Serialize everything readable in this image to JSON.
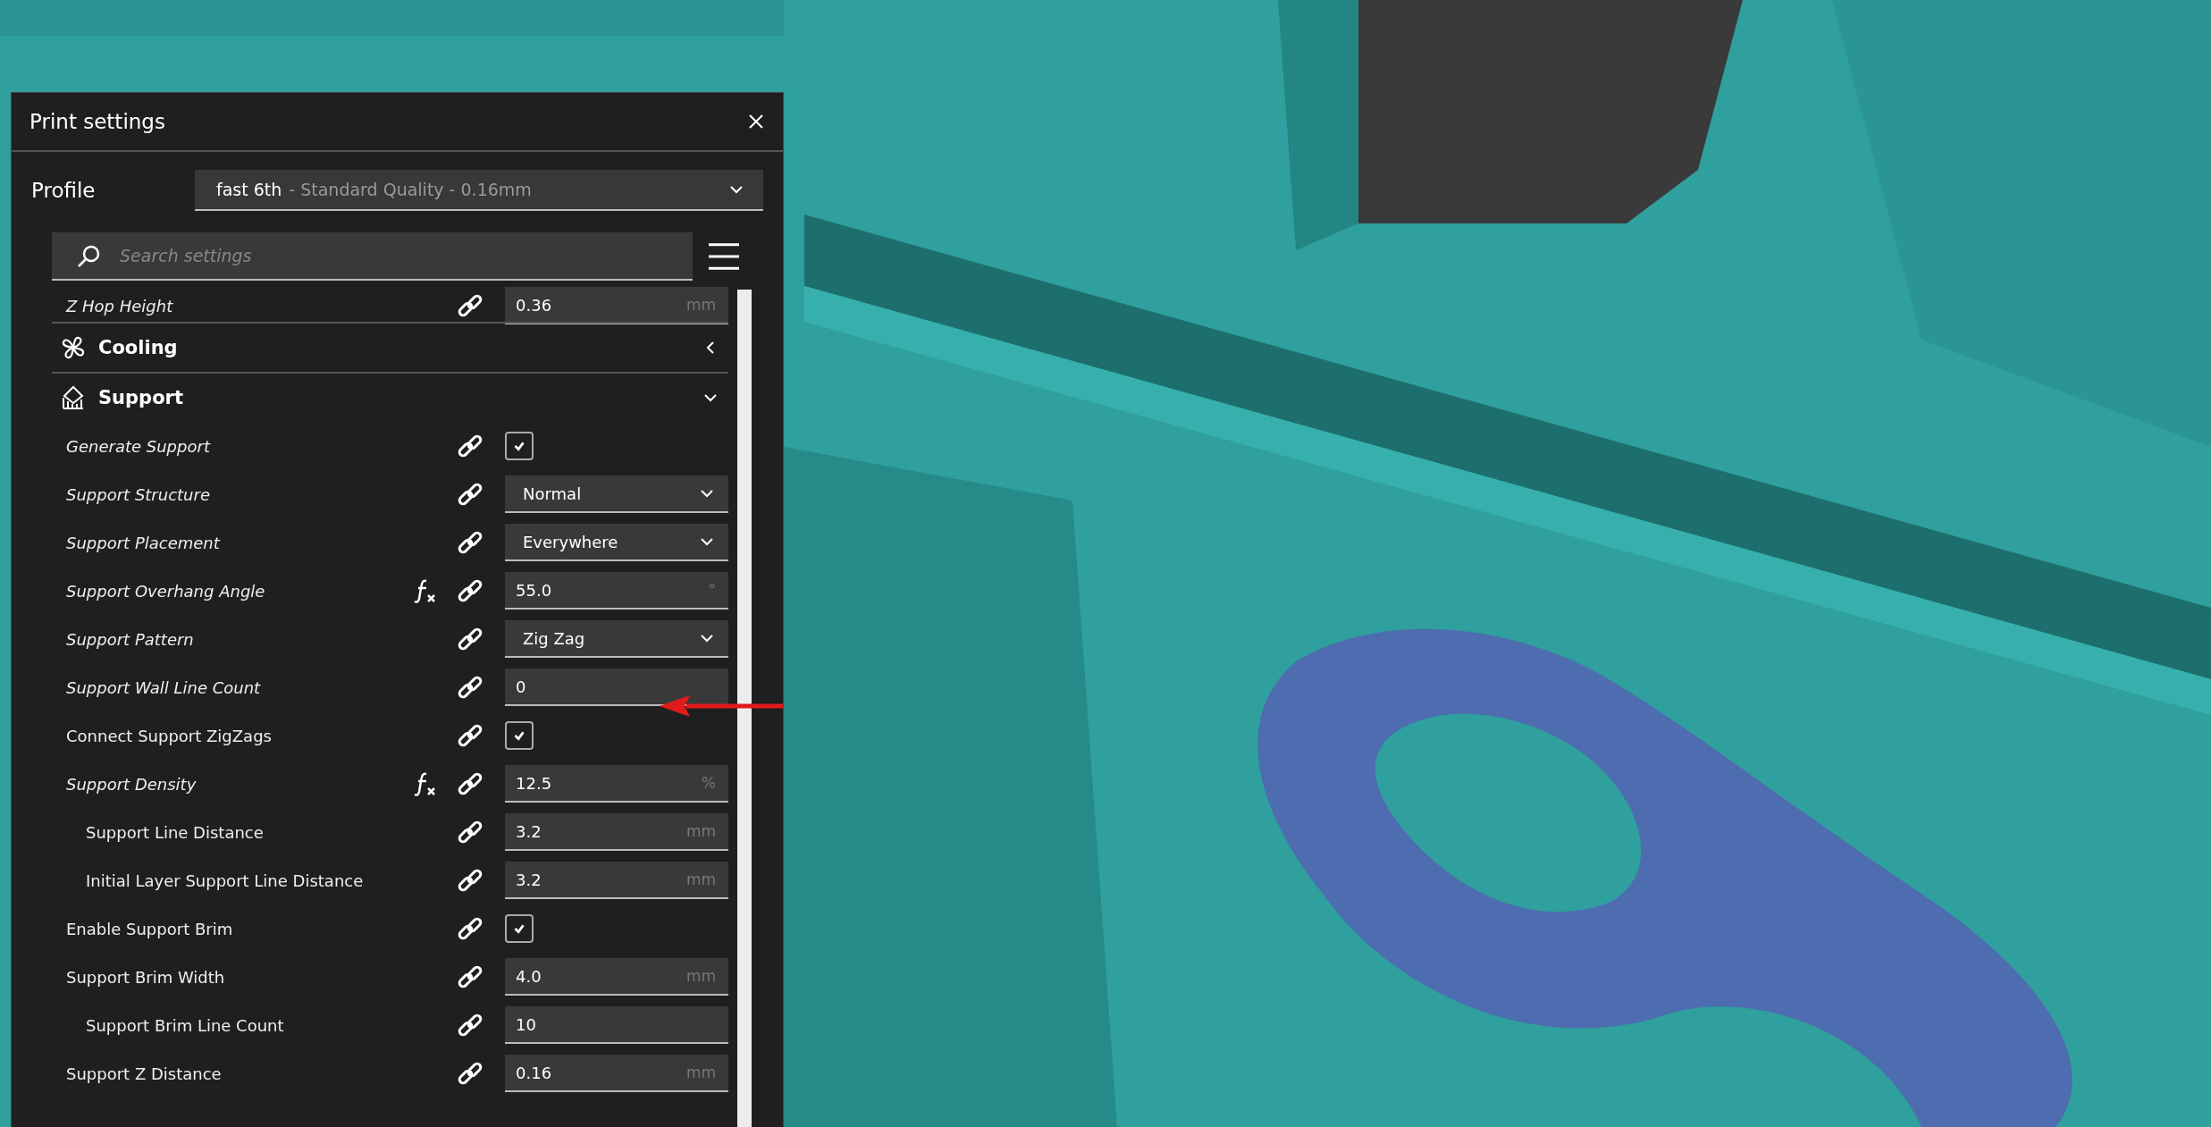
{
  "window": {
    "title": "Print settings"
  },
  "profile": {
    "label": "Profile",
    "name": "fast 6th",
    "detail": "- Standard Quality - 0.16mm"
  },
  "search": {
    "placeholder": "Search settings"
  },
  "settings": [
    {
      "kind": "setting",
      "label": "Z Hop Height",
      "overridden": true,
      "has_function": false,
      "control": {
        "kind": "number",
        "value": "0.36",
        "unit": "mm"
      }
    },
    {
      "kind": "category",
      "label": "Cooling",
      "expanded": false
    },
    {
      "kind": "category",
      "label": "Support",
      "expanded": true,
      "children": [
        {
          "kind": "setting",
          "label": "Generate Support",
          "overridden": true,
          "has_function": false,
          "control": {
            "kind": "checkbox",
            "checked": true
          }
        },
        {
          "kind": "setting",
          "label": "Support Structure",
          "overridden": true,
          "has_function": false,
          "control": {
            "kind": "dropdown",
            "value": "Normal"
          }
        },
        {
          "kind": "setting",
          "label": "Support Placement",
          "overridden": true,
          "has_function": false,
          "control": {
            "kind": "dropdown",
            "value": "Everywhere"
          }
        },
        {
          "kind": "setting",
          "label": "Support Overhang Angle",
          "overridden": true,
          "has_function": true,
          "control": {
            "kind": "number",
            "value": "55.0",
            "unit": "°"
          }
        },
        {
          "kind": "setting",
          "label": "Support Pattern",
          "overridden": true,
          "has_function": false,
          "control": {
            "kind": "dropdown",
            "value": "Zig Zag"
          }
        },
        {
          "kind": "setting",
          "label": "Support Wall Line Count",
          "overridden": true,
          "has_function": false,
          "control": {
            "kind": "number",
            "value": "0"
          }
        },
        {
          "kind": "setting",
          "label": "Connect Support ZigZags",
          "overridden": false,
          "has_function": false,
          "control": {
            "kind": "checkbox",
            "checked": true
          }
        },
        {
          "kind": "setting",
          "label": "Support Density",
          "overridden": true,
          "has_function": true,
          "control": {
            "kind": "number",
            "value": "12.5",
            "unit": "%"
          },
          "children": [
            {
              "kind": "setting",
              "label": "Support Line Distance",
              "overridden": false,
              "has_function": false,
              "control": {
                "kind": "number",
                "value": "3.2",
                "unit": "mm"
              }
            },
            {
              "kind": "setting",
              "label": "Initial Layer Support Line Distance",
              "overridden": false,
              "has_function": false,
              "control": {
                "kind": "number",
                "value": "3.2",
                "unit": "mm"
              }
            }
          ]
        },
        {
          "kind": "setting",
          "label": "Enable Support Brim",
          "overridden": false,
          "has_function": false,
          "control": {
            "kind": "checkbox",
            "checked": true
          }
        },
        {
          "kind": "setting",
          "label": "Support Brim Width",
          "overridden": false,
          "has_function": false,
          "control": {
            "kind": "number",
            "value": "4.0",
            "unit": "mm"
          },
          "children": [
            {
              "kind": "setting",
              "label": "Support Brim Line Count",
              "overridden": false,
              "has_function": false,
              "control": {
                "kind": "number",
                "value": "10"
              }
            }
          ]
        },
        {
          "kind": "setting",
          "label": "Support Z Distance",
          "overridden": false,
          "has_function": false,
          "control": {
            "kind": "number",
            "value": "0.16",
            "unit": "mm"
          }
        }
      ]
    }
  ]
}
